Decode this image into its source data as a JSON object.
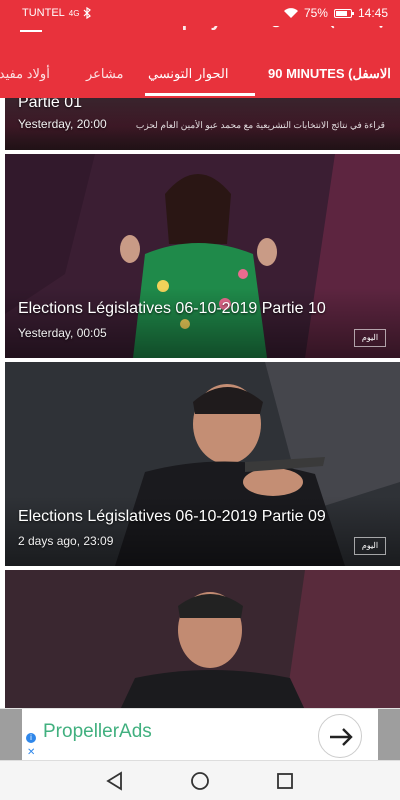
{
  "status_bar": {
    "carrier": "TUNTEL",
    "signal": "4G",
    "battery": "75%",
    "time": "14:45"
  },
  "app_bar": {
    "title": "Tunisia Replays",
    "icons": [
      "menu-icon",
      "refresh-icon",
      "search-icon",
      "more-icon"
    ]
  },
  "tabs": [
    {
      "label": "أولاد مفيدة",
      "active": false
    },
    {
      "label": "مشاعر",
      "active": false
    },
    {
      "label": "الحوار التونسي",
      "active": true
    },
    {
      "label": "90 MINUTES (الاسفل",
      "active": false
    }
  ],
  "cards": [
    {
      "title": "Partie 01",
      "meta": "Yesterday, 20:00",
      "ticker": "قراءة في نتائج الانتخابات التشريعية مع محمد عبو الأمين العام لحزب التيار الديمقراطي"
    },
    {
      "title": "Elections Législatives 06-10-2019 Partie 10",
      "meta": "Yesterday, 00:05",
      "logo": "اليوم"
    },
    {
      "title": "Elections Législatives 06-10-2019 Partie 09",
      "meta": "2 days ago, 23:09",
      "logo": "اليوم"
    },
    {
      "title": "",
      "meta": ""
    }
  ],
  "ad": {
    "brand": "PropellerAds",
    "info_icon": "info-icon",
    "close_icon": "close-icon",
    "arrow_icon": "arrow-right-icon"
  },
  "nav_bar": {
    "buttons": [
      "back-icon",
      "home-icon",
      "recent-apps-icon"
    ]
  },
  "colors": {
    "accent": "#e8323c",
    "ad_text": "#41b07f",
    "ad_info": "#2f87ea"
  }
}
